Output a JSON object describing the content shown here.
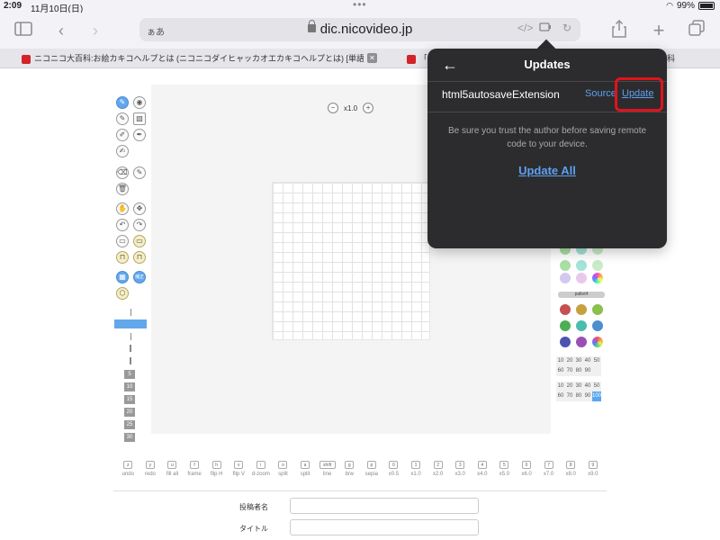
{
  "status_bar": {
    "time": "2:09",
    "date": "11月10日(日)",
    "battery": "99%"
  },
  "browser": {
    "url_prefix": "ぁあ",
    "domain": "dic.nicovideo.jp",
    "tabs": [
      {
        "title": "ニコニコ大百科:お絵カキコヘルプとは (ニコニコダイヒャッカオエカキコヘルプとは) [単語…"
      },
      {
        "title": "「コ"
      },
      {
        "title": "科"
      }
    ]
  },
  "popup": {
    "title": "Updates",
    "extension_name": "html5autosaveExtension",
    "source_label": "Source",
    "update_label": "Update",
    "warning_text": "Be sure you trust the author before saving remote code to your device.",
    "update_all_label": "Update All"
  },
  "editor": {
    "zoom_label": "x1.0",
    "palette_label": "pallet4",
    "opacity_rows_a": [
      "10",
      "20",
      "30",
      "40",
      "50",
      "60",
      "70",
      "80",
      "90",
      ""
    ],
    "opacity_rows_b": [
      "10",
      "20",
      "30",
      "40",
      "50",
      "60",
      "70",
      "80",
      "90",
      "100"
    ],
    "size_labels": [
      "5",
      "10",
      "15",
      "20",
      "25",
      "30"
    ],
    "shortcuts": [
      {
        "key": "z",
        "label": "undo"
      },
      {
        "key": "y",
        "label": "redo"
      },
      {
        "key": "u",
        "label": "fill all"
      },
      {
        "key": "f",
        "label": "frame"
      },
      {
        "key": "h",
        "label": "flip H"
      },
      {
        "key": "v",
        "label": "flip V"
      },
      {
        "key": "i",
        "label": "d-zoom"
      },
      {
        "key": "o",
        "label": "split"
      },
      {
        "key": "a",
        "label": "split"
      },
      {
        "key": "shift",
        "label": "line"
      },
      {
        "key": "g",
        "label": "b/w"
      },
      {
        "key": "p",
        "label": "sepia"
      },
      {
        "key": "0",
        "label": "x0.5"
      },
      {
        "key": "1",
        "label": "x1.0"
      },
      {
        "key": "2",
        "label": "x2.0"
      },
      {
        "key": "3",
        "label": "x3.0"
      },
      {
        "key": "4",
        "label": "x4.0"
      },
      {
        "key": "5",
        "label": "x5.0"
      },
      {
        "key": "6",
        "label": "x6.0"
      },
      {
        "key": "7",
        "label": "x7.0"
      },
      {
        "key": "8",
        "label": "x8.0"
      },
      {
        "key": "9",
        "label": "x9.0"
      }
    ],
    "grid_button_label": "補正",
    "form": {
      "poster_label": "投稿者名",
      "title_label": "タイトル"
    }
  },
  "colors": {
    "accent": "#5ea0f0",
    "highlight": "#e0131d",
    "popup_bg": "#2c2c2e",
    "palette_top": [
      "#a5d8a3",
      "#9fe3d6",
      "#c9e8c0",
      "#d6c6ee",
      "#e8c6ea",
      "#ddd07f"
    ],
    "palette4": [
      "#c65050",
      "#c8a040",
      "#8cbf4c",
      "#4cae54",
      "#4cbcb0",
      "#4a8fcf",
      "#4a55b0",
      "#9b4fb5",
      "#e0a050"
    ]
  }
}
